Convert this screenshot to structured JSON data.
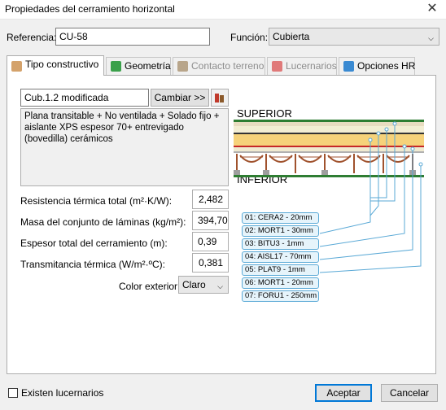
{
  "window": {
    "title": "Propiedades del cerramiento horizontal",
    "close": "✕"
  },
  "form": {
    "referencia_label": "Referencia:",
    "referencia_value": "CU-58",
    "funcion_label": "Función:",
    "funcion_value": "Cubierta"
  },
  "tabs": [
    {
      "label": "Tipo constructivo",
      "icon": "layers-icon",
      "color": "#d4a26b",
      "active": true
    },
    {
      "label": "Geometría",
      "icon": "geometry-icon",
      "color": "#3aa04a",
      "active": false
    },
    {
      "label": "Contacto terreno",
      "icon": "ground-contact-icon",
      "color": "#8b7355",
      "disabled": true
    },
    {
      "label": "Lucernarios",
      "icon": "skylight-icon",
      "color": "#d23a3a",
      "disabled": true
    },
    {
      "label": "Opciones HR",
      "icon": "humidity-icon",
      "color": "#3a8ad2",
      "active": false
    }
  ],
  "construction": {
    "name": "Cub.1.2 modificada",
    "change_button": "Cambiar >>",
    "description": "Plana transitable + No ventilada + Solado fijo + aislante XPS espesor 70+ entrevigado (bovedilla) cerámicos"
  },
  "properties": [
    {
      "label": "Resistencia térmica total (m²·K/W):",
      "value": "2,482"
    },
    {
      "label": "Masa del conjunto de láminas (kg/m²):",
      "value": "394,70"
    },
    {
      "label": "Espesor total del cerramiento (m):",
      "value": "0,39"
    },
    {
      "label": "Transmitancia térmica (W/m²·ºC):",
      "value": "0,381"
    }
  ],
  "color_exterior": {
    "label": "Color exterior:",
    "value": "Claro"
  },
  "section": {
    "top_label": "SUPERIOR",
    "bottom_label": "INFERIOR",
    "layers": [
      "01: CERA2 - 20mm",
      "02: MORT1 - 30mm",
      "03: BITU3 - 1mm",
      "04: AISL17 - 70mm",
      "05: PLAT9 - 1mm",
      "06: MORT1 - 20mm",
      "07: FORU1 - 250mm"
    ]
  },
  "footer": {
    "skylights_label": "Existen lucernarios",
    "accept": "Aceptar",
    "cancel": "Cancelar"
  },
  "colors": {
    "accent": "#0078d7",
    "layer_border": "#5aa9d6"
  }
}
